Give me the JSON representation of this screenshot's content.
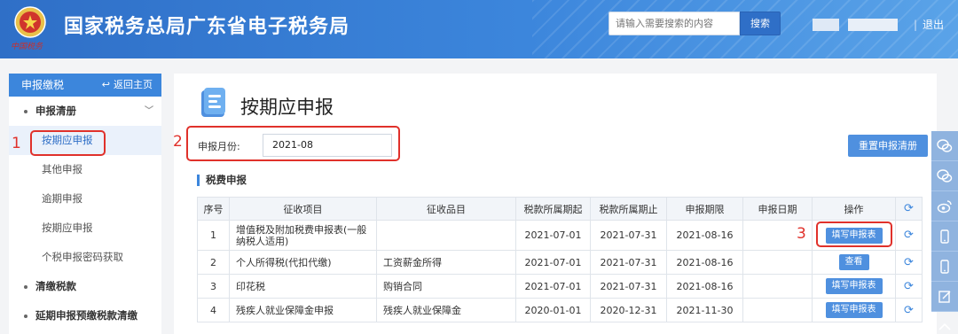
{
  "header": {
    "title": "国家税务总局广东省电子税务局",
    "search_placeholder": "请输入需要搜索的内容",
    "search_button": "搜索",
    "logout": "退出",
    "brand_color": "#3c86dc"
  },
  "sidebar": {
    "head": "申报缴税",
    "home": "返回主页",
    "items": [
      {
        "label": "申报清册",
        "type": "group"
      },
      {
        "label": "按期应申报",
        "type": "sub",
        "active": true
      },
      {
        "label": "其他申报",
        "type": "sub"
      },
      {
        "label": "逾期申报",
        "type": "sub"
      },
      {
        "label": "按期应申报",
        "type": "sub"
      },
      {
        "label": "个税申报密码获取",
        "type": "sub"
      },
      {
        "label": "清缴税款",
        "type": "group"
      },
      {
        "label": "延期申报预缴税款清缴",
        "type": "group"
      }
    ]
  },
  "annotations": [
    "1",
    "2",
    "3"
  ],
  "main": {
    "title": "按期应申报",
    "month_label": "申报月份:",
    "month_value": "2021-08",
    "reset_button": "重置申报清册",
    "section_title": "税费申报"
  },
  "table": {
    "headers": [
      "序号",
      "征收项目",
      "征收品目",
      "税款所属期起",
      "税款所属期止",
      "申报期限",
      "申报日期",
      "操作"
    ],
    "rows": [
      {
        "no": "1",
        "item": "增值税及附加税费申报表(一般纳税人适用)",
        "sub": "",
        "start": "2021-07-01",
        "end": "2021-07-31",
        "deadline": "2021-08-16",
        "date": "",
        "action": "填写申报表"
      },
      {
        "no": "2",
        "item": "个人所得税(代扣代缴)",
        "sub": "工资薪金所得",
        "start": "2021-07-01",
        "end": "2021-07-31",
        "deadline": "2021-08-16",
        "date": "",
        "action": "查看"
      },
      {
        "no": "3",
        "item": "印花税",
        "sub": "购销合同",
        "start": "2021-07-01",
        "end": "2021-07-31",
        "deadline": "2021-08-16",
        "date": "",
        "action": "填写申报表"
      },
      {
        "no": "4",
        "item": "残疾人就业保障金申报",
        "sub": "残疾人就业保障金",
        "start": "2020-01-01",
        "end": "2020-12-31",
        "deadline": "2021-11-30",
        "date": "",
        "action": "填写申报表"
      }
    ]
  },
  "tools": [
    "wechat-icon",
    "wechat-icon",
    "weibo-icon",
    "phone-icon",
    "phone-icon",
    "edit-icon",
    "back-to-top-icon"
  ]
}
